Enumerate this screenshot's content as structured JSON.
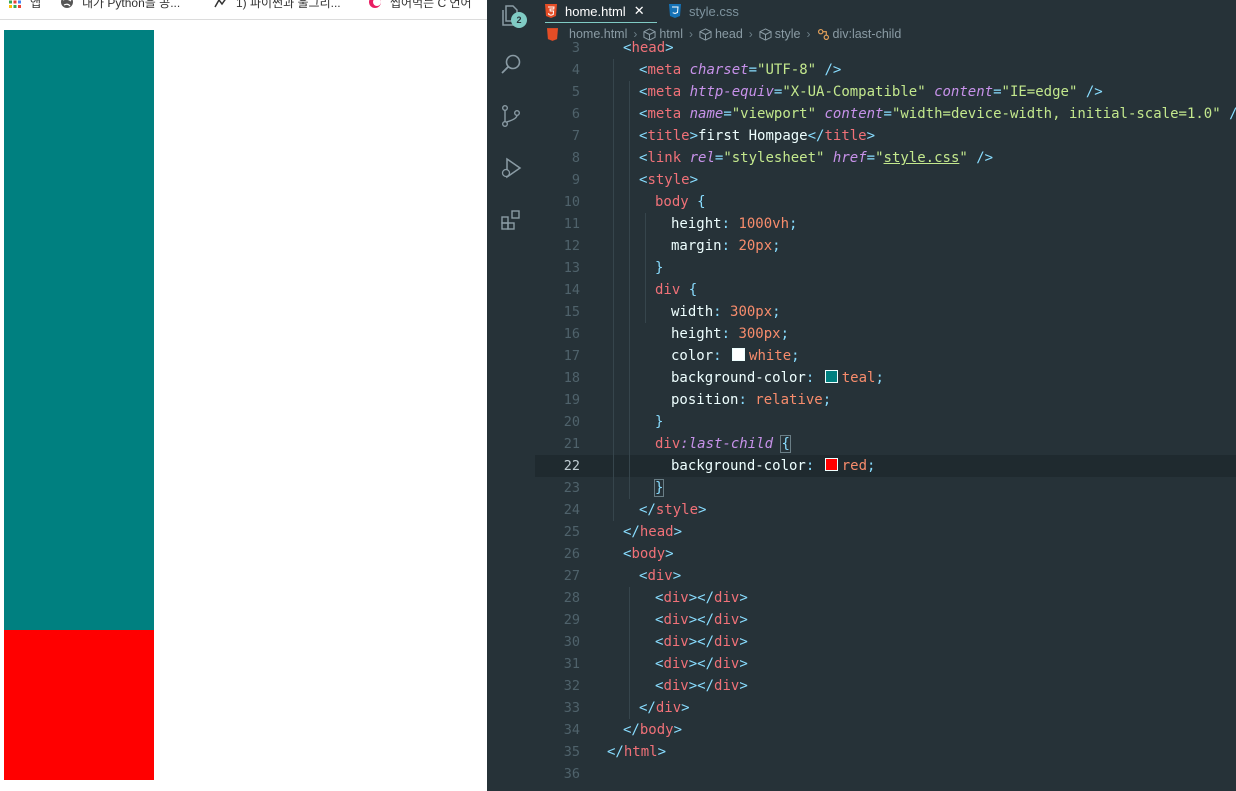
{
  "browser": {
    "bookmarks": [
      {
        "label": "앱",
        "icon": "apps-grid-icon"
      },
      {
        "label": "내가 Python을 공...",
        "icon": "globe-icon"
      },
      {
        "label": "1) 파이썬과 울그리...",
        "icon": "chart-icon"
      },
      {
        "label": "씹어먹는 C 언어",
        "icon": "site-favicon-icon"
      }
    ],
    "boxes": {
      "main_color": "#008080",
      "last_color": "#ff0000"
    }
  },
  "editor": {
    "activity": {
      "explorer_badge": "2",
      "icons": [
        "explorer-icon",
        "search-icon",
        "source-control-icon",
        "run-debug-icon",
        "extensions-icon"
      ]
    },
    "tabs": [
      {
        "label": "home.html",
        "active": true,
        "icon": "html-file-icon"
      },
      {
        "label": "style.css",
        "active": false,
        "icon": "css-file-icon"
      }
    ],
    "breadcrumbs": [
      "home.html",
      "html",
      "head",
      "style",
      "div:last-child"
    ],
    "current_line": 22,
    "lines": [
      {
        "n": "3",
        "tokens": [
          [
            "pn",
            "<"
          ],
          [
            "tg",
            "head"
          ],
          [
            "pn",
            ">"
          ]
        ]
      },
      {
        "n": "4",
        "tokens": [
          [
            "pn",
            "<"
          ],
          [
            "tg",
            "meta"
          ],
          [
            "tx",
            " "
          ],
          [
            "at",
            "charset"
          ],
          [
            "pn",
            "="
          ],
          [
            "st",
            "\"UTF-8\""
          ],
          [
            "tx",
            " "
          ],
          [
            "pn",
            "/>"
          ]
        ]
      },
      {
        "n": "5",
        "tokens": [
          [
            "pn",
            "<"
          ],
          [
            "tg",
            "meta"
          ],
          [
            "tx",
            " "
          ],
          [
            "at",
            "http-equiv"
          ],
          [
            "pn",
            "="
          ],
          [
            "st",
            "\"X-UA-Compatible\""
          ],
          [
            "tx",
            " "
          ],
          [
            "at",
            "content"
          ],
          [
            "pn",
            "="
          ],
          [
            "st",
            "\"IE=edge\""
          ],
          [
            "tx",
            " "
          ],
          [
            "pn",
            "/>"
          ]
        ]
      },
      {
        "n": "6",
        "tokens": [
          [
            "pn",
            "<"
          ],
          [
            "tg",
            "meta"
          ],
          [
            "tx",
            " "
          ],
          [
            "at",
            "name"
          ],
          [
            "pn",
            "="
          ],
          [
            "st",
            "\"viewport\""
          ],
          [
            "tx",
            " "
          ],
          [
            "at",
            "content"
          ],
          [
            "pn",
            "="
          ],
          [
            "st",
            "\"width=device-width, initial-scale=1.0\""
          ],
          [
            "tx",
            " "
          ],
          [
            "pn",
            "/>"
          ]
        ]
      },
      {
        "n": "7",
        "tokens": [
          [
            "pn",
            "<"
          ],
          [
            "tg",
            "title"
          ],
          [
            "pn",
            ">"
          ],
          [
            "tx",
            "first Hompage"
          ],
          [
            "pn",
            "</"
          ],
          [
            "tg",
            "title"
          ],
          [
            "pn",
            ">"
          ]
        ]
      },
      {
        "n": "8",
        "tokens": [
          [
            "pn",
            "<"
          ],
          [
            "tg",
            "link"
          ],
          [
            "tx",
            " "
          ],
          [
            "at",
            "rel"
          ],
          [
            "pn",
            "="
          ],
          [
            "st",
            "\"stylesheet\""
          ],
          [
            "tx",
            " "
          ],
          [
            "at",
            "href"
          ],
          [
            "pn",
            "="
          ],
          [
            "st",
            "\""
          ],
          [
            "st ul",
            "style.css"
          ],
          [
            "st",
            "\""
          ],
          [
            "tx",
            " "
          ],
          [
            "pn",
            "/>"
          ]
        ]
      },
      {
        "n": "9",
        "tokens": [
          [
            "pn",
            "<"
          ],
          [
            "tg",
            "style"
          ],
          [
            "pn",
            ">"
          ]
        ]
      },
      {
        "n": "10",
        "tokens": [
          [
            "tg",
            "body"
          ],
          [
            "tx",
            " "
          ],
          [
            "pn",
            "{"
          ]
        ]
      },
      {
        "n": "11",
        "tokens": [
          [
            "pr",
            "height"
          ],
          [
            "pn",
            ": "
          ],
          [
            "nu",
            "1000vh"
          ],
          [
            "pn",
            ";"
          ]
        ]
      },
      {
        "n": "12",
        "tokens": [
          [
            "pr",
            "margin"
          ],
          [
            "pn",
            ": "
          ],
          [
            "nu",
            "20px"
          ],
          [
            "pn",
            ";"
          ]
        ]
      },
      {
        "n": "13",
        "tokens": [
          [
            "pn",
            "}"
          ]
        ]
      },
      {
        "n": "14",
        "tokens": [
          [
            "tg",
            "div"
          ],
          [
            "tx",
            " "
          ],
          [
            "pn",
            "{"
          ]
        ]
      },
      {
        "n": "15",
        "tokens": [
          [
            "pr",
            "width"
          ],
          [
            "pn",
            ": "
          ],
          [
            "nu",
            "300px"
          ],
          [
            "pn",
            ";"
          ]
        ]
      },
      {
        "n": "16",
        "tokens": [
          [
            "pr",
            "height"
          ],
          [
            "pn",
            ": "
          ],
          [
            "nu",
            "300px"
          ],
          [
            "pn",
            ";"
          ]
        ]
      },
      {
        "n": "17",
        "tokens": [
          [
            "pr",
            "color"
          ],
          [
            "pn",
            ": "
          ],
          [
            "sw",
            "#ffffff"
          ],
          [
            "nu",
            "white"
          ],
          [
            "pn",
            ";"
          ]
        ]
      },
      {
        "n": "18",
        "tokens": [
          [
            "pr",
            "background-color"
          ],
          [
            "pn",
            ": "
          ],
          [
            "sw",
            "#008080"
          ],
          [
            "nu",
            "teal"
          ],
          [
            "pn",
            ";"
          ]
        ]
      },
      {
        "n": "19",
        "tokens": [
          [
            "pr",
            "position"
          ],
          [
            "pn",
            ": "
          ],
          [
            "nu",
            "relative"
          ],
          [
            "pn",
            ";"
          ]
        ]
      },
      {
        "n": "20",
        "tokens": [
          [
            "pn",
            "}"
          ]
        ]
      },
      {
        "n": "21",
        "tokens": [
          [
            "tg",
            "div"
          ],
          [
            "ps",
            ":last-child"
          ],
          [
            "tx",
            " "
          ],
          [
            "pn bm-brace",
            "{"
          ]
        ]
      },
      {
        "n": "22",
        "tokens": [
          [
            "pr",
            "background-color"
          ],
          [
            "pn",
            ": "
          ],
          [
            "sw",
            "#ff0000"
          ],
          [
            "nu",
            "red"
          ],
          [
            "pn",
            ";"
          ]
        ]
      },
      {
        "n": "23",
        "tokens": [
          [
            "pn bm-brace",
            "}"
          ]
        ]
      },
      {
        "n": "24",
        "tokens": [
          [
            "pn",
            "</"
          ],
          [
            "tg",
            "style"
          ],
          [
            "pn",
            ">"
          ]
        ]
      },
      {
        "n": "25",
        "tokens": [
          [
            "pn",
            "</"
          ],
          [
            "tg",
            "head"
          ],
          [
            "pn",
            ">"
          ]
        ]
      },
      {
        "n": "26",
        "tokens": [
          [
            "pn",
            "<"
          ],
          [
            "tg",
            "body"
          ],
          [
            "pn",
            ">"
          ]
        ]
      },
      {
        "n": "27",
        "tokens": [
          [
            "pn",
            "<"
          ],
          [
            "tg",
            "div"
          ],
          [
            "pn",
            ">"
          ]
        ]
      },
      {
        "n": "28",
        "tokens": [
          [
            "pn",
            "<"
          ],
          [
            "tg",
            "div"
          ],
          [
            "pn",
            "></"
          ],
          [
            "tg",
            "div"
          ],
          [
            "pn",
            ">"
          ]
        ]
      },
      {
        "n": "29",
        "tokens": [
          [
            "pn",
            "<"
          ],
          [
            "tg",
            "div"
          ],
          [
            "pn",
            "></"
          ],
          [
            "tg",
            "div"
          ],
          [
            "pn",
            ">"
          ]
        ]
      },
      {
        "n": "30",
        "tokens": [
          [
            "pn",
            "<"
          ],
          [
            "tg",
            "div"
          ],
          [
            "pn",
            "></"
          ],
          [
            "tg",
            "div"
          ],
          [
            "pn",
            ">"
          ]
        ]
      },
      {
        "n": "31",
        "tokens": [
          [
            "pn",
            "<"
          ],
          [
            "tg",
            "div"
          ],
          [
            "pn",
            "></"
          ],
          [
            "tg",
            "div"
          ],
          [
            "pn",
            ">"
          ]
        ]
      },
      {
        "n": "32",
        "tokens": [
          [
            "pn",
            "<"
          ],
          [
            "tg",
            "div"
          ],
          [
            "pn",
            "></"
          ],
          [
            "tg",
            "div"
          ],
          [
            "pn",
            ">"
          ]
        ]
      },
      {
        "n": "33",
        "tokens": [
          [
            "pn",
            "</"
          ],
          [
            "tg",
            "div"
          ],
          [
            "pn",
            ">"
          ]
        ]
      },
      {
        "n": "34",
        "tokens": [
          [
            "pn",
            "</"
          ],
          [
            "tg",
            "body"
          ],
          [
            "pn",
            ">"
          ]
        ]
      },
      {
        "n": "35",
        "tokens": [
          [
            "pn",
            "</"
          ],
          [
            "tg",
            "html"
          ],
          [
            "pn",
            ">"
          ]
        ]
      },
      {
        "n": "36",
        "tokens": []
      }
    ]
  }
}
